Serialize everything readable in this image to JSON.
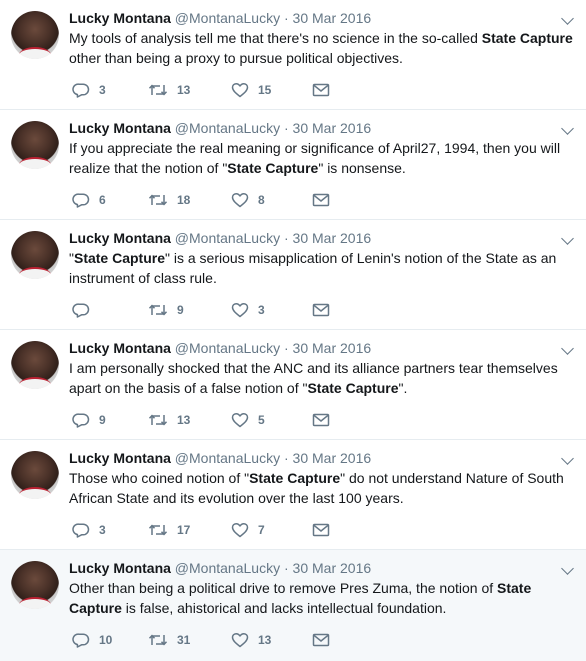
{
  "author": {
    "name": "Lucky Montana",
    "handle": "@MontanaLucky",
    "separator": "·"
  },
  "tweets": [
    {
      "date": "30 Mar 2016",
      "segments": [
        {
          "t": "My tools of analysis tell me that there's no science in the so-called ",
          "b": false
        },
        {
          "t": "State Capture",
          "b": true
        },
        {
          "t": " other than being a proxy to pursue political objectives.",
          "b": false
        }
      ],
      "replies": "3",
      "retweets": "13",
      "likes": "15"
    },
    {
      "date": "30 Mar 2016",
      "segments": [
        {
          "t": "If you appreciate the real meaning or significance of April27, 1994, then you will realize that the notion of \"",
          "b": false
        },
        {
          "t": "State Capture",
          "b": true
        },
        {
          "t": "\" is nonsense.",
          "b": false
        }
      ],
      "replies": "6",
      "retweets": "18",
      "likes": "8"
    },
    {
      "date": "30 Mar 2016",
      "segments": [
        {
          "t": "\"",
          "b": false
        },
        {
          "t": "State Capture",
          "b": true
        },
        {
          "t": "\" is a serious misapplication of Lenin's notion of the State as an instrument of class rule.",
          "b": false
        }
      ],
      "replies": "",
      "retweets": "9",
      "likes": "3"
    },
    {
      "date": "30 Mar 2016",
      "segments": [
        {
          "t": "I am personally shocked that the ANC and its alliance partners tear themselves apart on the basis of a false notion of \"",
          "b": false
        },
        {
          "t": "State Capture",
          "b": true
        },
        {
          "t": "\".",
          "b": false
        }
      ],
      "replies": "9",
      "retweets": "13",
      "likes": "5"
    },
    {
      "date": "30 Mar 2016",
      "segments": [
        {
          "t": "Those who coined notion of \"",
          "b": false
        },
        {
          "t": "State Capture",
          "b": true
        },
        {
          "t": "\" do not understand Nature of South African State and its evolution over the last 100 years.",
          "b": false
        }
      ],
      "replies": "3",
      "retweets": "17",
      "likes": "7"
    },
    {
      "date": "30 Mar 2016",
      "segments": [
        {
          "t": "Other than being a political drive to remove Pres Zuma, the notion of ",
          "b": false
        },
        {
          "t": "State Capture",
          "b": true
        },
        {
          "t": " is false, ahistorical and lacks intellectual foundation.",
          "b": false
        }
      ],
      "replies": "10",
      "retweets": "31",
      "likes": "13",
      "highlighted": true
    }
  ],
  "icons": {
    "reply": "reply-icon",
    "retweet": "retweet-icon",
    "like": "heart-icon",
    "dm": "envelope-icon",
    "menu": "chevron-down-icon"
  },
  "colors": {
    "text": "#14171a",
    "muted": "#657786",
    "border": "#e6ecf0",
    "highlight": "#f5f8fa"
  }
}
